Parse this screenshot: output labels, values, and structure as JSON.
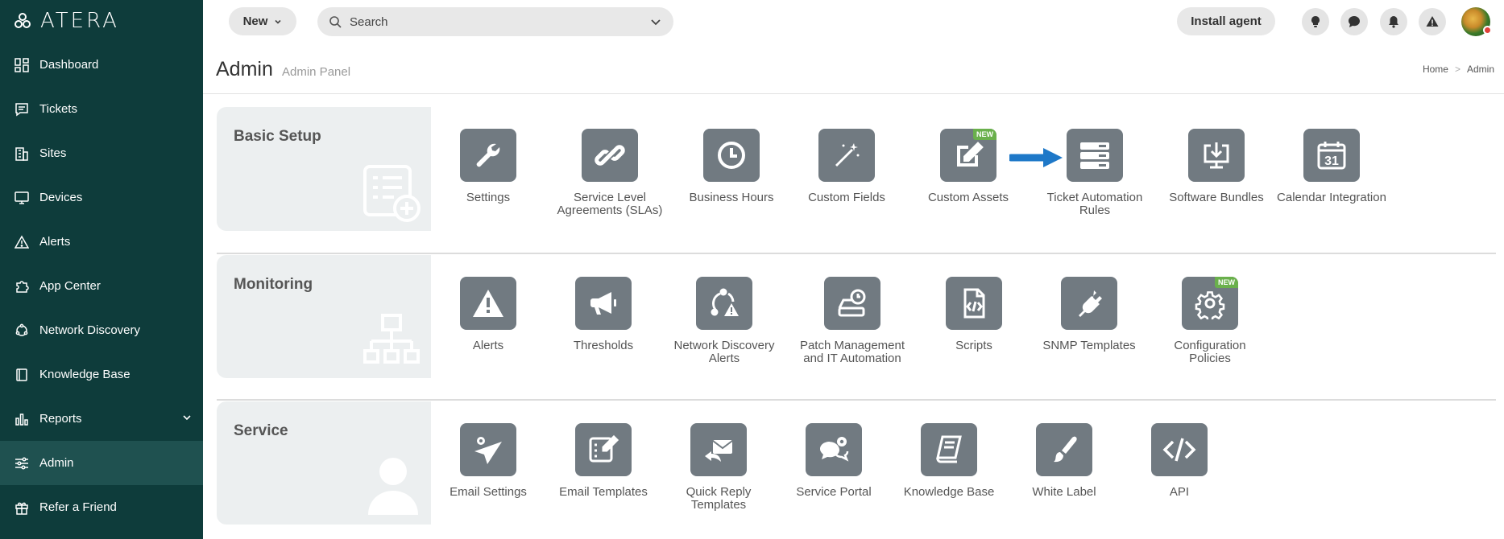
{
  "brand": {
    "logo_text": "ATERA"
  },
  "sidebar": {
    "items": [
      {
        "label": "Dashboard"
      },
      {
        "label": "Tickets"
      },
      {
        "label": "Sites"
      },
      {
        "label": "Devices"
      },
      {
        "label": "Alerts"
      },
      {
        "label": "App Center"
      },
      {
        "label": "Network Discovery"
      },
      {
        "label": "Knowledge Base"
      },
      {
        "label": "Reports"
      },
      {
        "label": "Admin"
      },
      {
        "label": "Refer a Friend"
      }
    ],
    "active": "Admin"
  },
  "topbar": {
    "new_label": "New",
    "search_placeholder": "Search",
    "install_label": "Install agent"
  },
  "header": {
    "title": "Admin",
    "subtitle": "Admin Panel",
    "breadcrumb": {
      "home": "Home",
      "sep": ">",
      "current": "Admin"
    }
  },
  "sections": {
    "basic": {
      "title": "Basic Setup",
      "tiles": [
        {
          "label": "Settings",
          "icon": "wrench-icon"
        },
        {
          "label": "Service Level Agreements (SLAs)",
          "icon": "link-icon"
        },
        {
          "label": "Business Hours",
          "icon": "clock-icon"
        },
        {
          "label": "Custom Fields",
          "icon": "magic-wand-icon"
        },
        {
          "label": "Custom Assets",
          "icon": "edit-icon",
          "badge": "NEW"
        },
        {
          "label": "Ticket Automation Rules",
          "icon": "server-icon"
        },
        {
          "label": "Software Bundles",
          "icon": "download-monitor-icon"
        },
        {
          "label": "Calendar Integration",
          "icon": "calendar-icon",
          "calendar_day": "31"
        }
      ]
    },
    "monitoring": {
      "title": "Monitoring",
      "tiles": [
        {
          "label": "Alerts",
          "icon": "warning-icon"
        },
        {
          "label": "Thresholds",
          "icon": "megaphone-icon"
        },
        {
          "label": "Network Discovery Alerts",
          "icon": "network-alert-icon"
        },
        {
          "label": "Patch Management and IT Automation",
          "icon": "drive-clock-icon"
        },
        {
          "label": "Scripts",
          "icon": "code-file-icon"
        },
        {
          "label": "SNMP Templates",
          "icon": "plug-icon"
        },
        {
          "label": "Configuration Policies",
          "icon": "gear-icon",
          "badge": "NEW"
        }
      ]
    },
    "service": {
      "title": "Service",
      "tiles": [
        {
          "label": "Email Settings",
          "icon": "paper-plane-gear-icon"
        },
        {
          "label": "Email Templates",
          "icon": "template-edit-icon"
        },
        {
          "label": "Quick Reply Templates",
          "icon": "envelope-reply-icon"
        },
        {
          "label": "Service Portal",
          "icon": "chat-gear-icon"
        },
        {
          "label": "Knowledge Base",
          "icon": "book-icon"
        },
        {
          "label": "White Label",
          "icon": "brush-icon"
        },
        {
          "label": "API",
          "icon": "code-brackets-icon"
        }
      ]
    }
  },
  "colors": {
    "sidebar_bg": "#0e3c3b",
    "sidebar_active": "#1f5150",
    "tile_bg": "#717a81",
    "badge_green": "#6ab04c",
    "arrow_blue": "#1e78c8"
  }
}
